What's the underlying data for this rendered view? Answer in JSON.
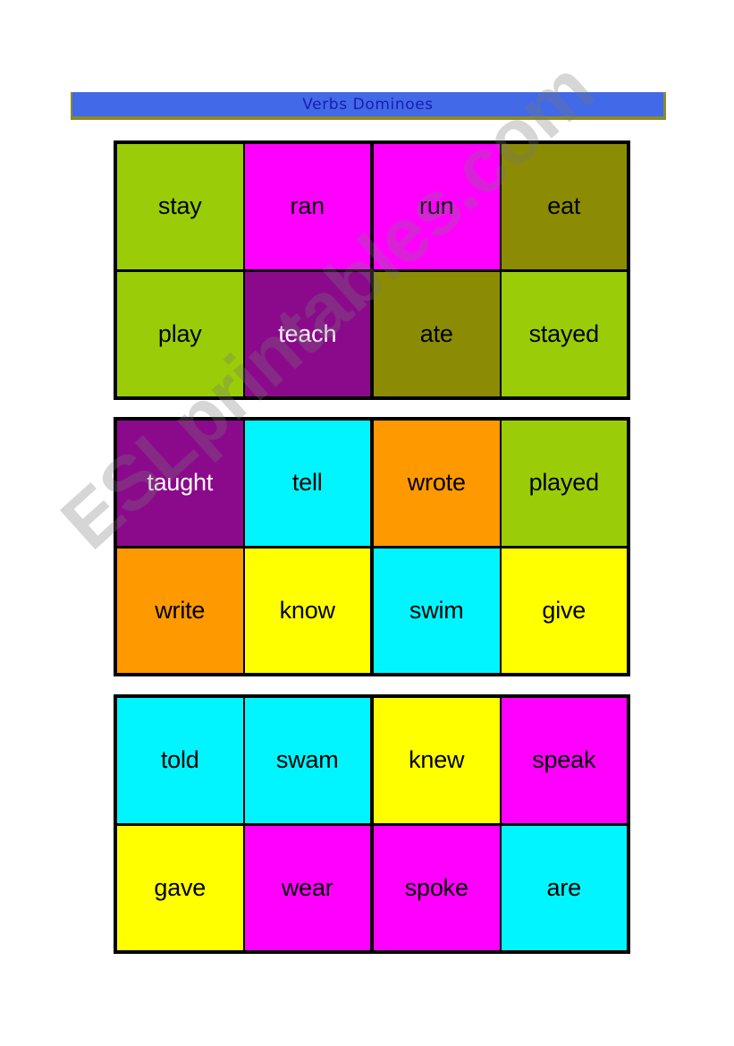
{
  "title": {
    "text": "Verbs Dominoes",
    "bar_color": "#4169E8",
    "text_color": "#1C1CB0",
    "border_color": "#8A8A2A"
  },
  "watermark": {
    "text": "ESLprintables.com"
  },
  "palette": {
    "yellow_green": "#9ACD07",
    "magenta": "#FF00FF",
    "olive": "#8C8C04",
    "purple": "#8B0A8B",
    "cyan": "#00F5FF",
    "orange": "#FF9900",
    "yellow": "#FFFF00",
    "black": "#000000",
    "white": "#FFFFFF"
  },
  "blocks": [
    {
      "id": "block-1",
      "rows": [
        {
          "id": "row-1-top",
          "cells": [
            {
              "label": "stay",
              "bg": "#9ACD07",
              "fg": "#000000"
            },
            {
              "label": "ran",
              "bg": "#FF00FF",
              "fg": "#000000"
            },
            {
              "label": "run",
              "bg": "#FF00FF",
              "fg": "#000000"
            },
            {
              "label": "eat",
              "bg": "#8C8C04",
              "fg": "#000000"
            }
          ]
        },
        {
          "id": "row-1-bottom",
          "cells": [
            {
              "label": "play",
              "bg": "#9ACD07",
              "fg": "#000000"
            },
            {
              "label": "teach",
              "bg": "#8B0A8B",
              "fg": "#FFFFFF"
            },
            {
              "label": "ate",
              "bg": "#8C8C04",
              "fg": "#000000"
            },
            {
              "label": "stayed",
              "bg": "#9ACD07",
              "fg": "#000000"
            }
          ]
        }
      ]
    },
    {
      "id": "block-2",
      "rows": [
        {
          "id": "row-2-top",
          "cells": [
            {
              "label": "taught",
              "bg": "#8B0A8B",
              "fg": "#FFFFFF"
            },
            {
              "label": "tell",
              "bg": "#00F5FF",
              "fg": "#000000"
            },
            {
              "label": "wrote",
              "bg": "#FF9900",
              "fg": "#000000"
            },
            {
              "label": "played",
              "bg": "#9ACD07",
              "fg": "#000000"
            }
          ]
        },
        {
          "id": "row-2-bottom",
          "cells": [
            {
              "label": "write",
              "bg": "#FF9900",
              "fg": "#000000"
            },
            {
              "label": "know",
              "bg": "#FFFF00",
              "fg": "#000000"
            },
            {
              "label": "swim",
              "bg": "#00F5FF",
              "fg": "#000000"
            },
            {
              "label": "give",
              "bg": "#FFFF00",
              "fg": "#000000"
            }
          ]
        }
      ]
    },
    {
      "id": "block-3",
      "rows": [
        {
          "id": "row-3-top",
          "cells": [
            {
              "label": "told",
              "bg": "#00F5FF",
              "fg": "#000000"
            },
            {
              "label": "swam",
              "bg": "#00F5FF",
              "fg": "#000000"
            },
            {
              "label": "knew",
              "bg": "#FFFF00",
              "fg": "#000000"
            },
            {
              "label": "speak",
              "bg": "#FF00FF",
              "fg": "#000000"
            }
          ]
        },
        {
          "id": "row-3-bottom",
          "cells": [
            {
              "label": "gave",
              "bg": "#FFFF00",
              "fg": "#000000"
            },
            {
              "label": "wear",
              "bg": "#FF00FF",
              "fg": "#000000"
            },
            {
              "label": "spoke",
              "bg": "#FF00FF",
              "fg": "#000000"
            },
            {
              "label": "are",
              "bg": "#00F5FF",
              "fg": "#000000"
            }
          ]
        }
      ]
    }
  ]
}
